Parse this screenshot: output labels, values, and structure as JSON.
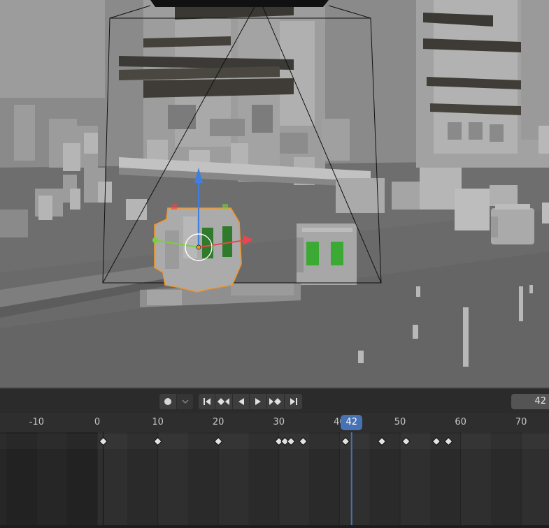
{
  "timeline": {
    "current_frame": "42",
    "frame_field_value": "42",
    "ruler_labels": [
      "-10",
      "0",
      "10",
      "20",
      "30",
      "40",
      "50",
      "60",
      "70"
    ],
    "keyframes": [
      1,
      10,
      20,
      30,
      31,
      32,
      34,
      41,
      47,
      51,
      56,
      58
    ],
    "transport_buttons": [
      "jump-start",
      "prev-keyframe",
      "play-reverse",
      "play",
      "next-keyframe",
      "jump-end"
    ],
    "record_button": "record-icon",
    "record_dropdown": "chevron-down-icon"
  },
  "colors": {
    "accent": "#4772b3",
    "selection_outline": "#f0972e",
    "gizmo_x": "#e8474f",
    "gizmo_y": "#7bcf3c",
    "gizmo_z": "#3f7fe0",
    "green_panel": "#3aaa35"
  }
}
